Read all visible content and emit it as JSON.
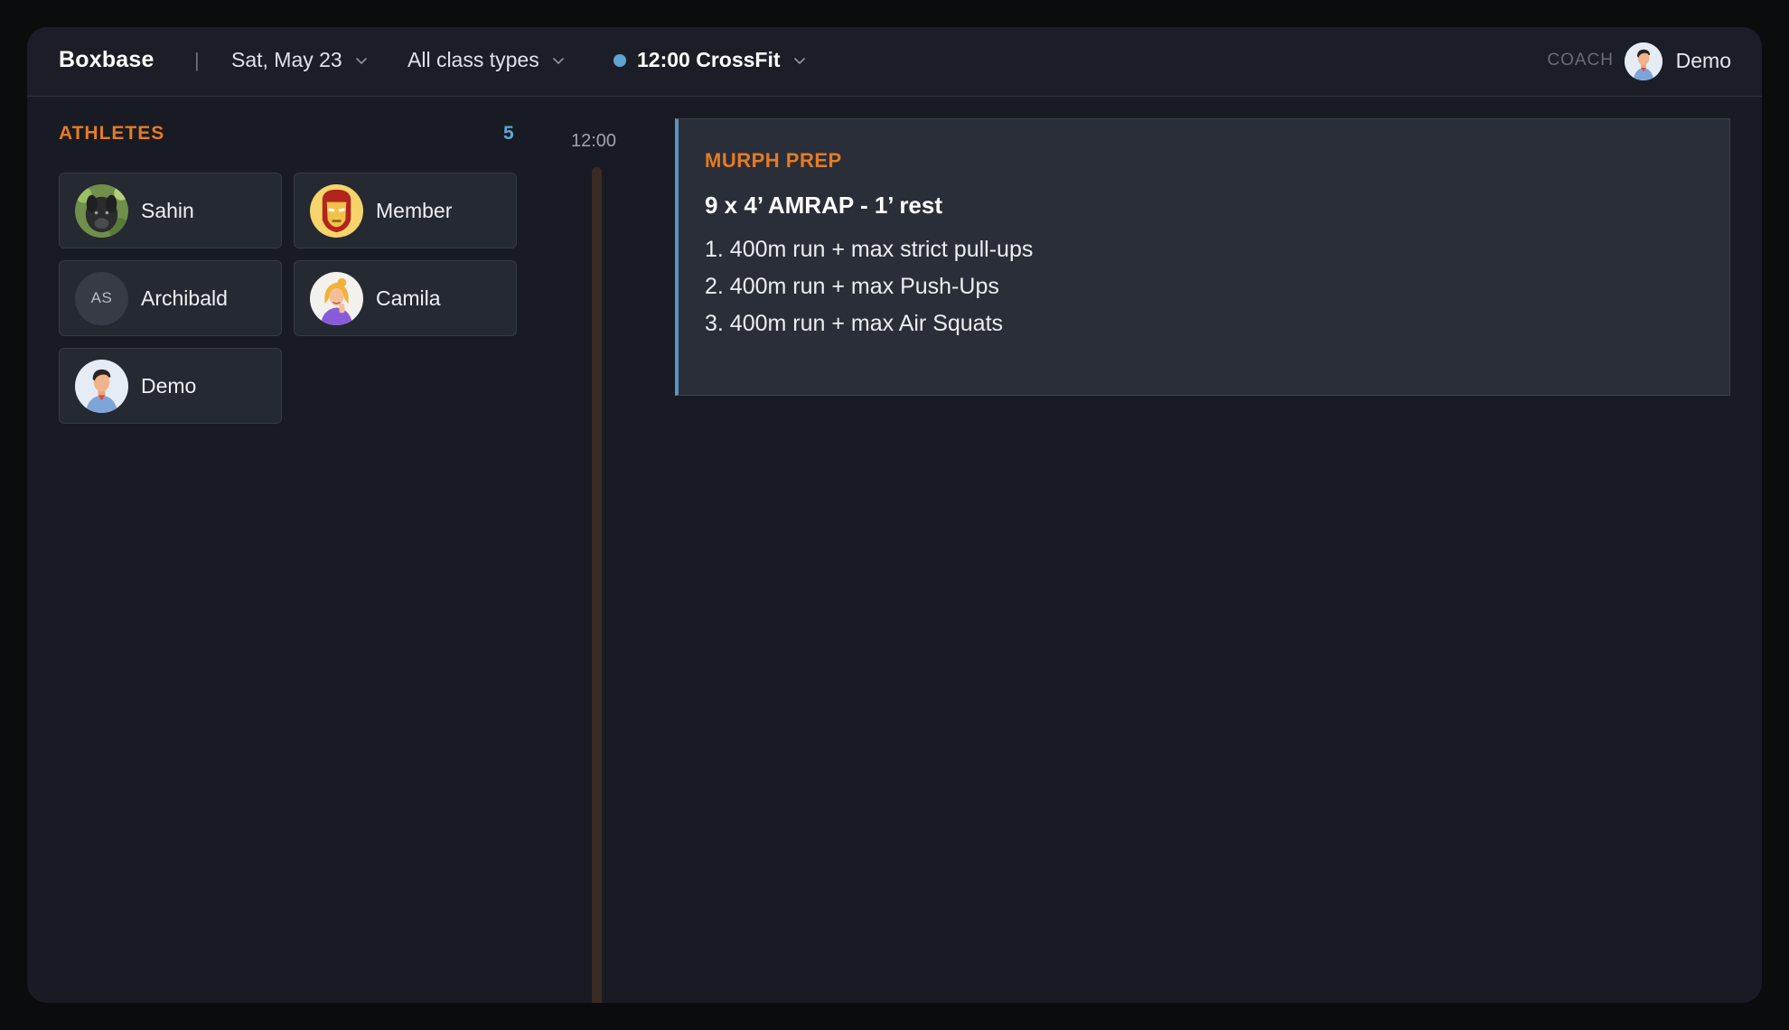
{
  "app": {
    "brand": "Boxbase",
    "separator": "|"
  },
  "header": {
    "date": "Sat, May 23",
    "class_filter": "All class types",
    "session": "12:00 CrossFit",
    "session_dot_color": "#5ea5d6",
    "role_label": "COACH",
    "user_name": "Demo"
  },
  "athletes": {
    "title": "ATHLETES",
    "count": "5",
    "items": [
      {
        "name": "Sahin",
        "avatar": "photo-dog"
      },
      {
        "name": "Member",
        "avatar": "ironman-icon"
      },
      {
        "name": "Archibald",
        "avatar": "initials",
        "initials": "AS"
      },
      {
        "name": "Camila",
        "avatar": "woman-illustration"
      },
      {
        "name": "Demo",
        "avatar": "man-illustration"
      }
    ]
  },
  "timeline": {
    "time": "12:00"
  },
  "workout": {
    "title": "MURPH PREP",
    "heading": "9 x 4’ AMRAP - 1’ rest",
    "items": [
      "1. 400m run + max strict pull-ups",
      "2. 400m run + max Push-Ups",
      "3. 400m run + max Air Squats"
    ]
  },
  "colors": {
    "accent_orange": "#e57b24",
    "accent_blue": "#5ea5d6",
    "background": "#181b23"
  }
}
